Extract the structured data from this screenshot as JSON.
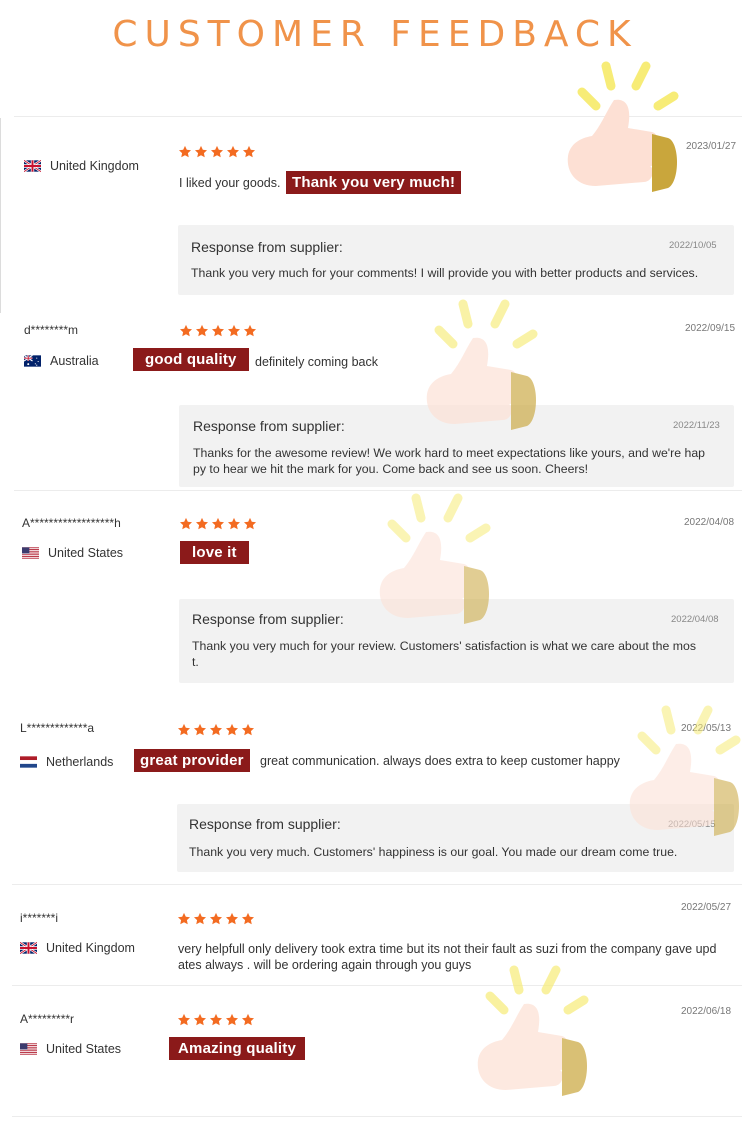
{
  "page_title": "CUSTOMER FEEDBACK",
  "colors": {
    "accent": "#f0934a",
    "tag": "#8b1a1a",
    "star": "#f36b21",
    "response_bg": "#f2f2f2"
  },
  "reviews": [
    {
      "user": "",
      "country": "United Kingdom",
      "flag": "uk-flag-icon",
      "rating": 5,
      "date": "2023/01/27",
      "text": "I liked your goods.",
      "tag": "Thank you very much!",
      "response": {
        "header": "Response from supplier:",
        "date": "2022/10/05",
        "text": "Thank you very much for your comments! I will provide you with better products and services."
      }
    },
    {
      "user": "d********m",
      "country": "Australia",
      "flag": "au-flag-icon",
      "rating": 5,
      "date": "2022/09/15",
      "tag": "good quality",
      "text": "definitely coming back",
      "response": {
        "header": "Response from supplier:",
        "date": "2022/11/23",
        "text_lines": [
          "Thanks for the awesome review! We work hard to meet expectations like yours, and we're hap",
          "py to hear we hit the mark for you. Come back and see us soon. Cheers!"
        ]
      }
    },
    {
      "user": "A******************h",
      "country": "United States",
      "flag": "us-flag-icon",
      "rating": 5,
      "date": "2022/04/08",
      "tag": "love it",
      "text": "",
      "response": {
        "header": "Response from supplier:",
        "date": "2022/04/08",
        "text_lines": [
          "Thank you very much for your review. Customers' satisfaction is what we care about the mos",
          "t."
        ]
      }
    },
    {
      "user": "L*************a",
      "country": "Netherlands",
      "flag": "nl-flag-icon",
      "rating": 5,
      "date": "2022/05/13",
      "tag": "great provider",
      "text": "great communication. always does extra to keep customer happy",
      "response": {
        "header": "Response from supplier:",
        "date": "2022/05/15",
        "text": "Thank you very much. Customers' happiness is our goal. You made our dream come true."
      }
    },
    {
      "user": "i*******i",
      "country": "United Kingdom",
      "flag": "uk-flag-icon",
      "rating": 5,
      "date": "2022/05/27",
      "tag": "",
      "text_lines": [
        "very helpfull only delivery took extra time but its not their fault as suzi from the company gave upd",
        "ates always . will be ordering again through you guys"
      ]
    },
    {
      "user": "A*********r",
      "country": "United States",
      "flag": "us-flag-icon",
      "rating": 5,
      "date": "2022/06/18",
      "tag": "Amazing quality",
      "text": ""
    }
  ]
}
